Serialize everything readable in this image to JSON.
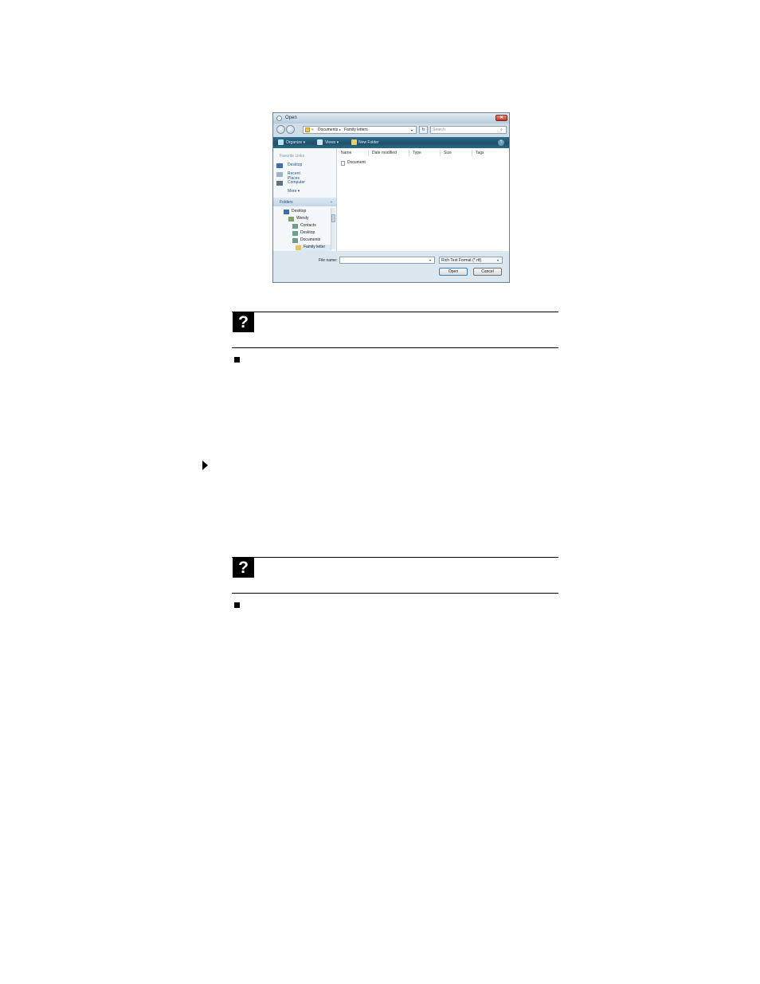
{
  "dialog": {
    "title": "Open",
    "close_glyph": "✕",
    "address": {
      "chevron": "«",
      "crumbs": [
        "Documents",
        "Family letters"
      ],
      "separator": "▸",
      "dropdown": "▾",
      "refresh_glyph": "↻"
    },
    "search_placeholder": "Search",
    "search_glyph": "⌕",
    "toolbar": {
      "organize": "Organize ▾",
      "views": "Views ▾",
      "new_folder": "New Folder",
      "help_glyph": "?"
    },
    "favorite_links": {
      "header": "Favorite Links",
      "items": [
        "Desktop",
        "Recent Places",
        "Computer"
      ],
      "more": "More ▾"
    },
    "folders": {
      "label": "Folders",
      "chevron": "⌄",
      "tree": [
        "Desktop",
        "Wendy",
        "Contacts",
        "Desktop",
        "Documents",
        "Family letter"
      ]
    },
    "columns": [
      "Name",
      "Date modified",
      "Type",
      "Size",
      "Tags"
    ],
    "files": [
      "Document"
    ],
    "file_name_label": "File name:",
    "file_name_value": "",
    "file_name_dropdown": "▾",
    "file_type": "Rich Text Format (*.rtf)",
    "file_type_dropdown": "▾",
    "open_button": "Open",
    "cancel_button": "Cancel"
  },
  "help_icon_glyph": "?",
  "colors": {
    "toolbar": "#1e4f6a",
    "link": "#1f4f86",
    "help_icon_bg": "#000000"
  },
  "icons": [
    "back-arrow-icon",
    "forward-arrow-icon",
    "folder-icon",
    "search-icon",
    "help-icon",
    "bullet-square-icon",
    "triangle-marker-icon"
  ]
}
